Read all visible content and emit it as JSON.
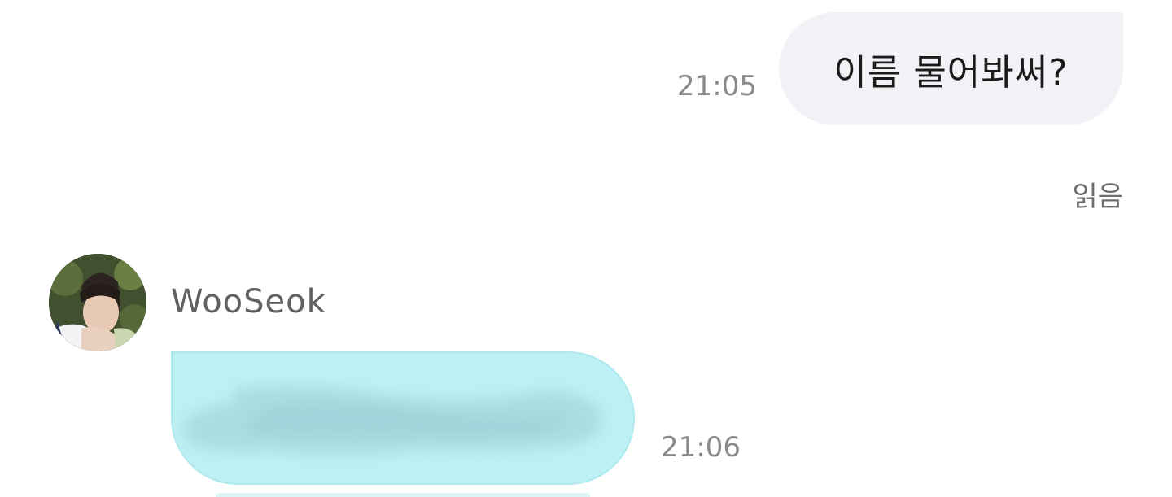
{
  "messages": {
    "outgoing": {
      "text": "이름 물어봐써?",
      "time": "21:05",
      "status": "읽음"
    },
    "incoming": {
      "sender": "WooSeok",
      "time": "21:06",
      "avatar_icon": "profile-photo",
      "content_redacted": true
    }
  },
  "colors": {
    "outgoing_bubble": "#f1f2f6",
    "incoming_bubble": "#bdf0f4",
    "timestamp": "#8a8a8a",
    "sender_name": "#616161"
  }
}
